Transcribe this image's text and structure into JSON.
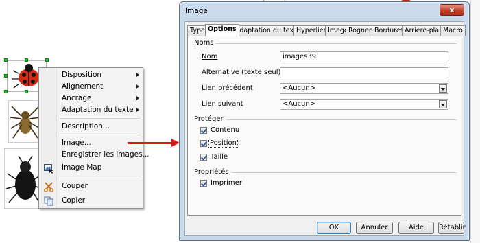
{
  "context_menu": {
    "items": [
      {
        "label": "Disposition",
        "u": "D"
      },
      {
        "label": "Alignement",
        "u": "A"
      },
      {
        "label": "Ancrage",
        "u": "A"
      },
      {
        "label": "Adaptation du texte",
        "u": "A"
      },
      {
        "label": "Description...",
        "u": "D"
      },
      {
        "label": "Image...",
        "u": "I"
      },
      {
        "label": "Enregistrer les images...",
        "u": "E"
      },
      {
        "label": "Image Map",
        "u": "M"
      },
      {
        "label": "Couper",
        "u": "C"
      },
      {
        "label": "Copier",
        "u": "C"
      }
    ],
    "icons": [
      "image-map-icon",
      "scissors-icon",
      "copy-icon"
    ]
  },
  "dialog": {
    "title": "Image",
    "close_label": "x",
    "tabs": [
      "Type",
      "Options",
      "Adaptation du texte",
      "Hyperlien",
      "Image",
      "Rogner",
      "Bordures",
      "Arrière-plan",
      "Macro"
    ],
    "active_tab": "Options",
    "names_group": "Noms",
    "name_label": "Nom",
    "name_value": "images39",
    "alt_label": "Alternative (texte seul)",
    "alt_value": "",
    "prev_label": "Lien précédent",
    "prev_value": "<Aucun>",
    "next_label": "Lien suivant",
    "next_value": "<Aucun>",
    "protect_group": "Protéger",
    "protect_content": "Contenu",
    "protect_position": "Position",
    "protect_size": "Taille",
    "props_group": "Propriétés",
    "print_label": "Imprimer",
    "buttons": {
      "ok": "OK",
      "cancel": "Annuler",
      "help": "Aide",
      "reset": "Rétablir"
    }
  },
  "colors": {
    "arrow": "#e01515",
    "selection_handle": "#19c31d"
  }
}
